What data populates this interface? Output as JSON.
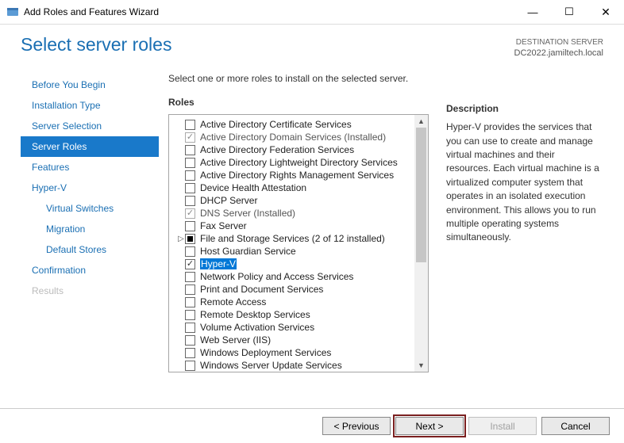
{
  "titlebar": {
    "title": "Add Roles and Features Wizard"
  },
  "header": {
    "page_title": "Select server roles",
    "destination_label": "DESTINATION SERVER",
    "destination_server": "DC2022.jamiltech.local"
  },
  "nav": {
    "items": [
      {
        "label": "Before You Begin",
        "disabled": false
      },
      {
        "label": "Installation Type",
        "disabled": false
      },
      {
        "label": "Server Selection",
        "disabled": false
      },
      {
        "label": "Server Roles",
        "active": true
      },
      {
        "label": "Features",
        "disabled": false
      },
      {
        "label": "Hyper-V",
        "disabled": false
      },
      {
        "label": "Virtual Switches",
        "sub": true
      },
      {
        "label": "Migration",
        "sub": true
      },
      {
        "label": "Default Stores",
        "sub": true
      },
      {
        "label": "Confirmation",
        "disabled": false
      },
      {
        "label": "Results",
        "disabled": true
      }
    ]
  },
  "main": {
    "instruction": "Select one or more roles to install on the selected server.",
    "roles_label": "Roles",
    "desc_label": "Description",
    "description": "Hyper-V provides the services that you can use to create and manage virtual machines and their resources. Each virtual machine is a virtualized computer system that operates in an isolated execution environment. This allows you to run multiple operating systems simultaneously.",
    "roles": [
      {
        "label": "Active Directory Certificate Services",
        "state": "unchecked"
      },
      {
        "label": "Active Directory Domain Services (Installed)",
        "state": "checked-disabled"
      },
      {
        "label": "Active Directory Federation Services",
        "state": "unchecked"
      },
      {
        "label": "Active Directory Lightweight Directory Services",
        "state": "unchecked"
      },
      {
        "label": "Active Directory Rights Management Services",
        "state": "unchecked"
      },
      {
        "label": "Device Health Attestation",
        "state": "unchecked"
      },
      {
        "label": "DHCP Server",
        "state": "unchecked"
      },
      {
        "label": "DNS Server (Installed)",
        "state": "checked-disabled"
      },
      {
        "label": "Fax Server",
        "state": "unchecked"
      },
      {
        "label": "File and Storage Services (2 of 12 installed)",
        "state": "mixed",
        "expandable": true
      },
      {
        "label": "Host Guardian Service",
        "state": "unchecked"
      },
      {
        "label": "Hyper-V",
        "state": "checked",
        "selected": true
      },
      {
        "label": "Network Policy and Access Services",
        "state": "unchecked"
      },
      {
        "label": "Print and Document Services",
        "state": "unchecked"
      },
      {
        "label": "Remote Access",
        "state": "unchecked"
      },
      {
        "label": "Remote Desktop Services",
        "state": "unchecked"
      },
      {
        "label": "Volume Activation Services",
        "state": "unchecked"
      },
      {
        "label": "Web Server (IIS)",
        "state": "unchecked"
      },
      {
        "label": "Windows Deployment Services",
        "state": "unchecked"
      },
      {
        "label": "Windows Server Update Services",
        "state": "unchecked"
      }
    ]
  },
  "footer": {
    "previous": "< Previous",
    "next": "Next >",
    "install": "Install",
    "cancel": "Cancel"
  }
}
